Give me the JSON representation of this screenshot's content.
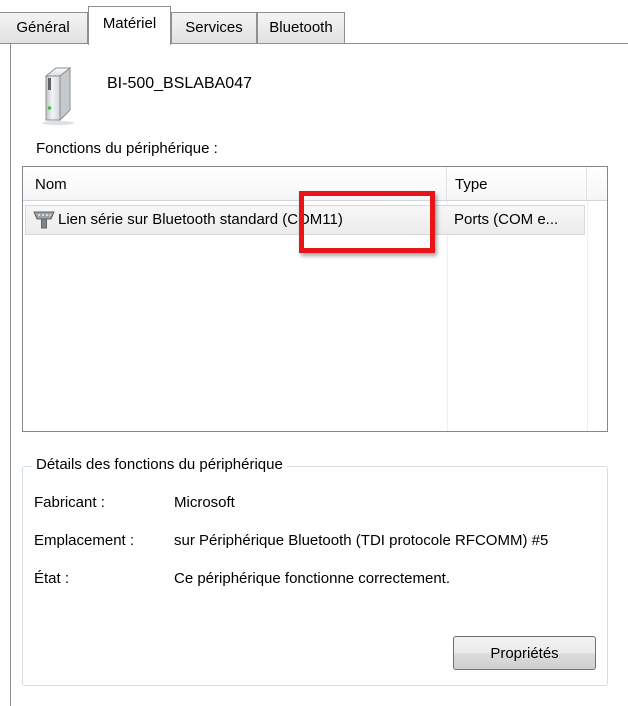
{
  "tabs": [
    {
      "label": "Général"
    },
    {
      "label": "Matériel"
    },
    {
      "label": "Services"
    },
    {
      "label": "Bluetooth"
    }
  ],
  "active_tab": "Matériel",
  "device": {
    "name": "BI-500_BSLABA047",
    "icon": "printer-device-icon"
  },
  "functions": {
    "label": "Fonctions du périphérique :",
    "columns": [
      {
        "label": "Nom"
      },
      {
        "label": "Type"
      }
    ],
    "rows": [
      {
        "name": "Lien série sur Bluetooth standard (COM11)",
        "type": "Ports (COM e...",
        "icon": "serial-port-icon"
      }
    ]
  },
  "annotation": {
    "highlight_color": "#e8141a"
  },
  "details": {
    "title": "Détails des fonctions du périphérique",
    "fabricant_label": "Fabricant :",
    "fabricant_value": "Microsoft",
    "emplacement_label": "Emplacement :",
    "emplacement_value": "sur Périphérique Bluetooth (TDI protocole RFCOMM) #5",
    "etat_label": "État :",
    "etat_value": "Ce périphérique fonctionne correctement."
  },
  "buttons": {
    "properties_label": "Propriétés"
  },
  "colors": {
    "border": "#8e8f8f",
    "listview_border": "#828790",
    "group_border": "#d5dfe5"
  }
}
